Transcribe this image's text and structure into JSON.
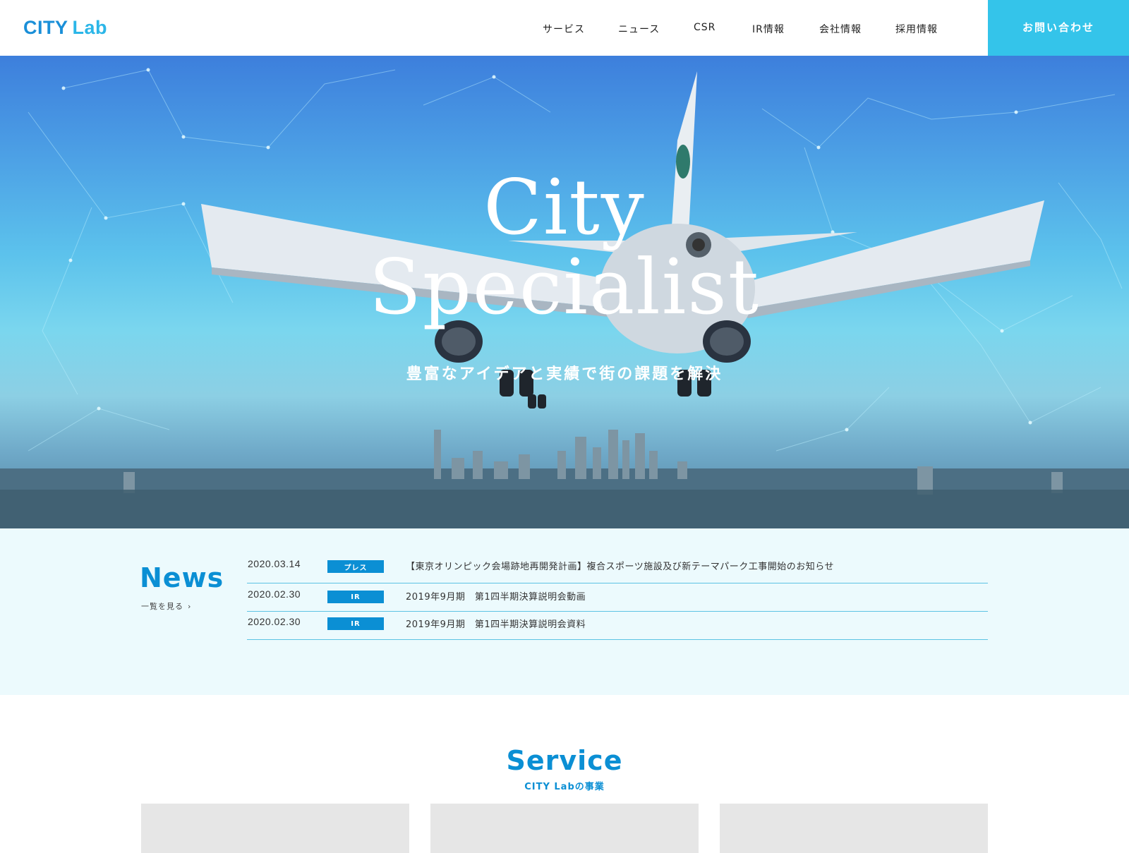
{
  "header": {
    "logo_city": "CITY",
    "logo_lab": "Lab",
    "nav": [
      "サービス",
      "ニュース",
      "CSR",
      "IR情報",
      "会社情報",
      "採用情報"
    ],
    "contact_label": "お問い合わせ"
  },
  "hero": {
    "title_line1": "City",
    "title_line2": "Specialist",
    "subtitle": "豊富なアイデアと実績で街の課題を解決"
  },
  "news": {
    "heading": "News",
    "more_label": "一覧を見る",
    "items": [
      {
        "date": "2020.03.14",
        "category": "プレス",
        "title": "【東京オリンピック会場跡地再開発計画】複合スポーツ施設及び新テーマパーク工事開始のお知らせ"
      },
      {
        "date": "2020.02.30",
        "category": "IR",
        "title": "2019年9月期　第1四半期決算説明会動画"
      },
      {
        "date": "2020.02.30",
        "category": "IR",
        "title": "2019年9月期　第1四半期決算説明会資料"
      }
    ]
  },
  "service": {
    "heading": "Service",
    "subtitle": "CITY Labの事業"
  },
  "colors": {
    "brand_blue": "#0b8fd4",
    "accent_cyan": "#34c4ea",
    "news_bg": "#ecfafd"
  }
}
